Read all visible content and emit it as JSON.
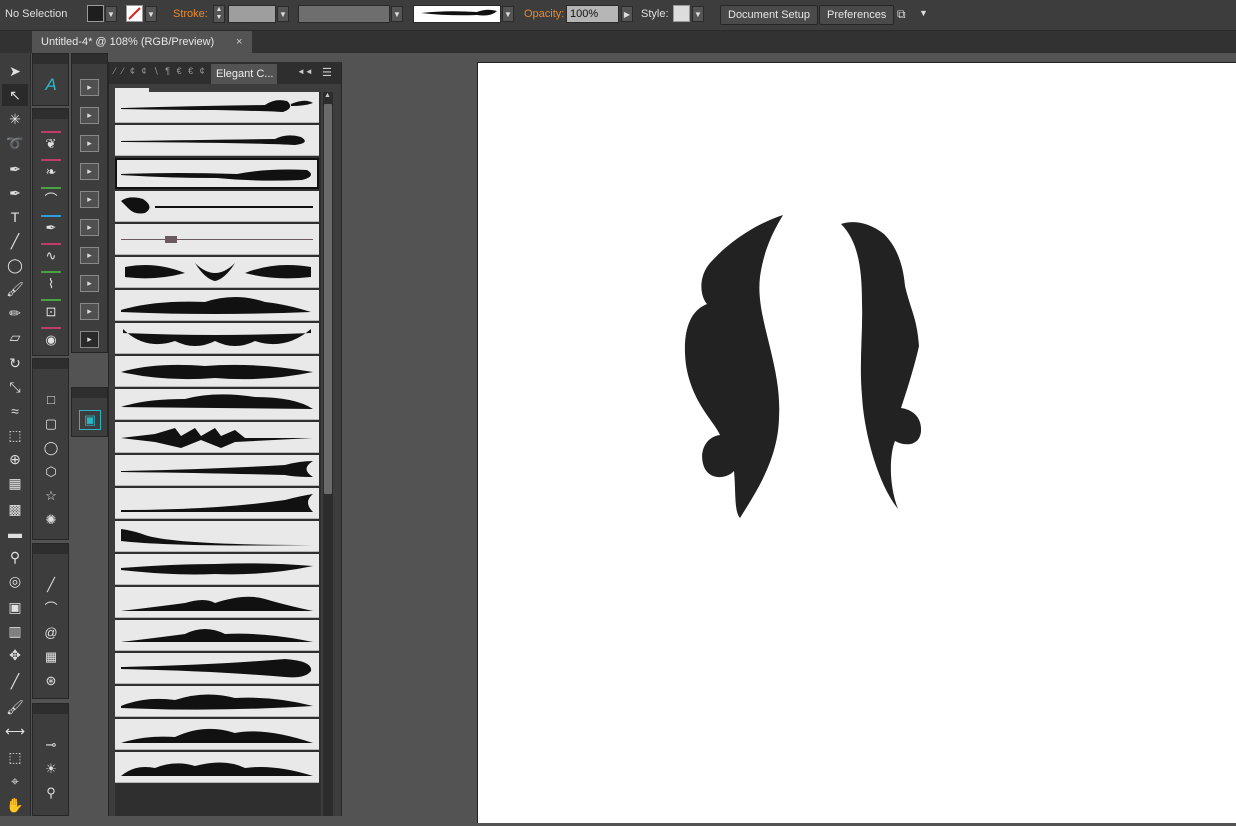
{
  "controlbar": {
    "selection_label": "No Selection",
    "stroke_label": "Stroke:",
    "opacity_label": "Opacity:",
    "opacity_value": "100%",
    "style_label": "Style:",
    "document_setup": "Document Setup",
    "preferences": "Preferences"
  },
  "document": {
    "tab_title": "Untitled-4* @ 108% (RGB/Preview)",
    "close_glyph": "×"
  },
  "symbols_panel": {
    "active_tab": "Elegant C...",
    "inactive_tab_glyphs": "⁄ ⁄ ¢ ¢ ∖ ¶ € € ¢",
    "collapse_glyph": "◄◄",
    "menu_glyph": "☰",
    "symbol_count": 21
  },
  "colors": {
    "ui_dark": "#3d3d3d",
    "pasteboard": "#535353",
    "artboard": "#ffffff",
    "accent_orange": "#e8892b",
    "ornament": "#222222"
  }
}
